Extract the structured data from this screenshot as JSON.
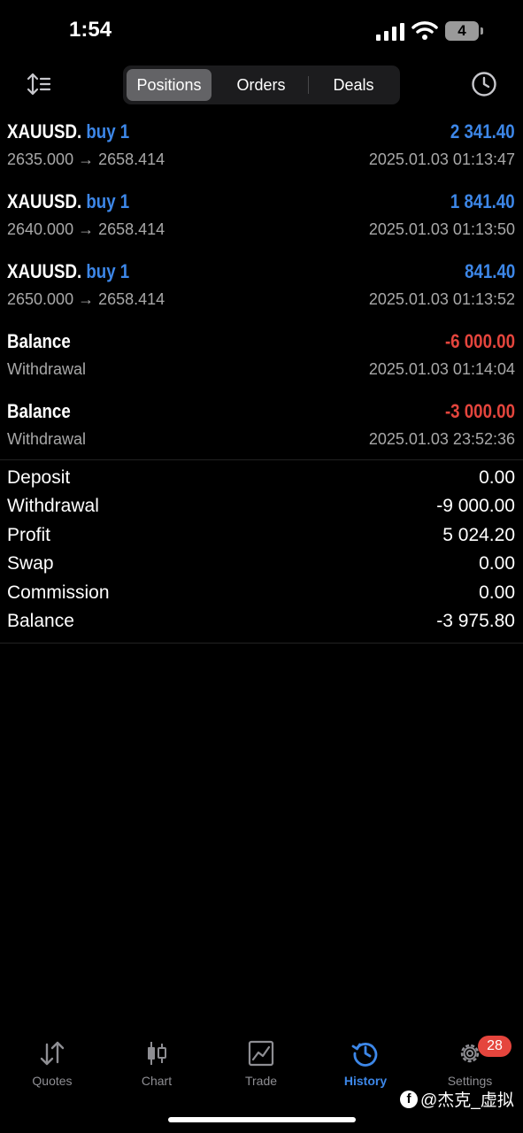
{
  "status": {
    "time": "1:54",
    "battery": "4"
  },
  "tabs": [
    {
      "label": "Positions",
      "active": true
    },
    {
      "label": "Orders",
      "active": false
    },
    {
      "label": "Deals",
      "active": false
    }
  ],
  "deals": [
    {
      "symbol": "XAUUSD.",
      "kind": "buy 1",
      "amount": "2 341.40",
      "amount_color": "blue",
      "prices": "2635.000 → 2658.414",
      "datetime": "2025.01.03 01:13:47"
    },
    {
      "symbol": "XAUUSD.",
      "kind": "buy 1",
      "amount": "1 841.40",
      "amount_color": "blue",
      "prices": "2640.000 → 2658.414",
      "datetime": "2025.01.03 01:13:50"
    },
    {
      "symbol": "XAUUSD.",
      "kind": "buy 1",
      "amount": "841.40",
      "amount_color": "blue",
      "prices": "2650.000 → 2658.414",
      "datetime": "2025.01.03 01:13:52"
    },
    {
      "symbol": "Balance",
      "kind": "",
      "amount": "-6 000.00",
      "amount_color": "red",
      "prices": "Withdrawal",
      "datetime": "2025.01.03 01:14:04"
    },
    {
      "symbol": "Balance",
      "kind": "",
      "amount": "-3 000.00",
      "amount_color": "red",
      "prices": "Withdrawal",
      "datetime": "2025.01.03 23:52:36"
    }
  ],
  "summary": [
    {
      "label": "Deposit",
      "value": "0.00"
    },
    {
      "label": "Withdrawal",
      "value": "-9 000.00"
    },
    {
      "label": "Profit",
      "value": "5 024.20"
    },
    {
      "label": "Swap",
      "value": "0.00"
    },
    {
      "label": "Commission",
      "value": "0.00"
    },
    {
      "label": "Balance",
      "value": "-3 975.80"
    }
  ],
  "tabbar": [
    {
      "label": "Quotes",
      "icon": "quotes-arrows-icon",
      "active": false
    },
    {
      "label": "Chart",
      "icon": "candlestick-icon",
      "active": false
    },
    {
      "label": "Trade",
      "icon": "trade-chart-icon",
      "active": false
    },
    {
      "label": "History",
      "icon": "history-icon",
      "active": true
    },
    {
      "label": "Settings",
      "icon": "gear-icon",
      "active": false
    }
  ],
  "settings_badge": "28",
  "watermark": "@杰克_虚拟",
  "colors": {
    "accent": "#3d87e8",
    "negative": "#e5453d",
    "background": "#000000"
  }
}
